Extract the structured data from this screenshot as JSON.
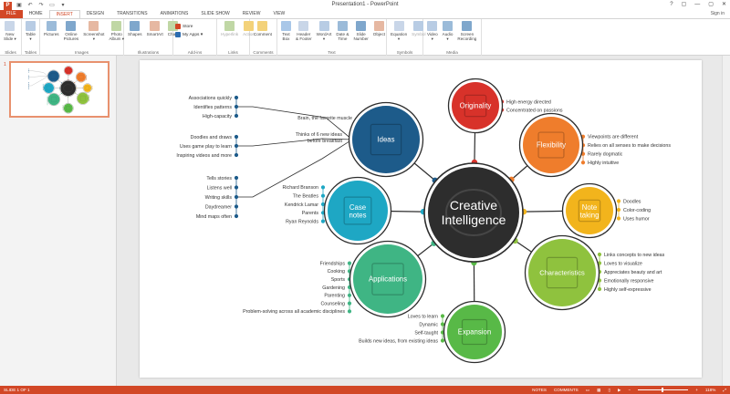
{
  "window": {
    "title": "Presentation1 - PowerPoint",
    "sign_in": "Sign in",
    "logo": "P",
    "controls": [
      "?",
      "▢",
      "—",
      "▢",
      "✕"
    ]
  },
  "tabs": [
    "FILE",
    "HOME",
    "INSERT",
    "DESIGN",
    "TRANSITIONS",
    "ANIMATIONS",
    "SLIDE SHOW",
    "REVIEW",
    "VIEW"
  ],
  "ribbon": {
    "groups": [
      {
        "label": "Slides",
        "buttons": [
          "New\nSlide ▾"
        ]
      },
      {
        "label": "Tables",
        "buttons": [
          "Table\n▾"
        ]
      },
      {
        "label": "Images",
        "buttons": [
          "Pictures",
          "Online\nPictures",
          "Screenshot\n▾",
          "Photo\nAlbum ▾"
        ]
      },
      {
        "label": "Illustrations",
        "buttons": [
          "Shapes",
          "SmartArt",
          "Chart"
        ]
      },
      {
        "label": "Add-ins",
        "addins": [
          "Store",
          "My Apps ▾"
        ]
      },
      {
        "label": "Links",
        "buttons": [
          "Hyperlink",
          "Action"
        ]
      },
      {
        "label": "Comments",
        "buttons": [
          "Comment"
        ]
      },
      {
        "label": "Text",
        "buttons": [
          "Text\nBox",
          "Header\n& Footer",
          "WordArt\n▾",
          "Date &\nTime",
          "Slide\nNumber",
          "Object"
        ]
      },
      {
        "label": "Symbols",
        "buttons": [
          "Equation\n▾",
          "Symbol"
        ]
      },
      {
        "label": "Media",
        "buttons": [
          "Video\n▾",
          "Audio\n▾",
          "Screen\nRecording"
        ]
      }
    ]
  },
  "thumbnail_pane": {
    "slide_number": "1"
  },
  "mindmap": {
    "center": {
      "line1": "Creative",
      "line2": "Intelligence",
      "color": "#2d2d2d"
    },
    "nodes": [
      {
        "id": "originality",
        "label": "Originality",
        "color": "#d8322a",
        "items": [
          "High energy directed",
          "Concentrated on passions"
        ]
      },
      {
        "id": "flexibility",
        "label": "Flexibility",
        "color": "#ef7d2c",
        "items": [
          "Viewpoints are different",
          "Relies on all senses to make decisions",
          "Rarely dogmatic",
          "Highly intuitive"
        ]
      },
      {
        "id": "notetaking",
        "label1": "Note",
        "label2": "taking",
        "color": "#f2b41c",
        "items": [
          "Doodles",
          "Color-coding",
          "Uses humor"
        ]
      },
      {
        "id": "characteristics",
        "label": "Characteristics",
        "color": "#8fc23e",
        "items": [
          "Links concepts to new ideas",
          "Loves to visualize",
          "Appreciates beauty and art",
          "Emotionally responsive",
          "Highly self-expressive"
        ]
      },
      {
        "id": "expansion",
        "label": "Expansion",
        "color": "#58b947",
        "items": [
          "Loves to learn",
          "Dynamic",
          "Self-taught",
          "Builds new ideas, from existing ideas"
        ]
      },
      {
        "id": "applications",
        "label": "Applications",
        "color": "#3fb584",
        "items": [
          "Friendships",
          "Cooking",
          "Sports",
          "Gardening",
          "Parenting",
          "Counseling",
          "Problem-solving across all academic disciplines"
        ]
      },
      {
        "id": "casenotes",
        "label1": "Case",
        "label2": "notes",
        "color": "#1ea7c4",
        "items": [
          "Richard Branson",
          "The Beatles",
          "Kendrick Lamar",
          "Parents",
          "Ryan Reynolds"
        ]
      },
      {
        "id": "ideas",
        "label": "Ideas",
        "color": "#1d5b8a",
        "sub": [
          {
            "label": "Brain, the favorite muscle",
            "items": [
              "Associations quickly",
              "Identifies patterns",
              "High-capacity"
            ]
          },
          {
            "label1": "Thinks of 6 new ideas",
            "label2": "before breakfast",
            "items": [
              "Doodles and draws",
              "Uses game play to learn",
              "Inspiring videos and more"
            ]
          },
          {
            "label": "",
            "items": [
              "Tells stories",
              "Listens well",
              "Writing skills",
              "Daydreamer",
              "Mind maps often"
            ]
          }
        ]
      }
    ]
  },
  "statusbar": {
    "slide_info": "SLIDE 1 OF 1",
    "notes": "NOTES",
    "comments": "COMMENTS",
    "zoom": "118%"
  },
  "colors": {
    "accent": "#d24726",
    "spoke": "#2d2d2d"
  }
}
